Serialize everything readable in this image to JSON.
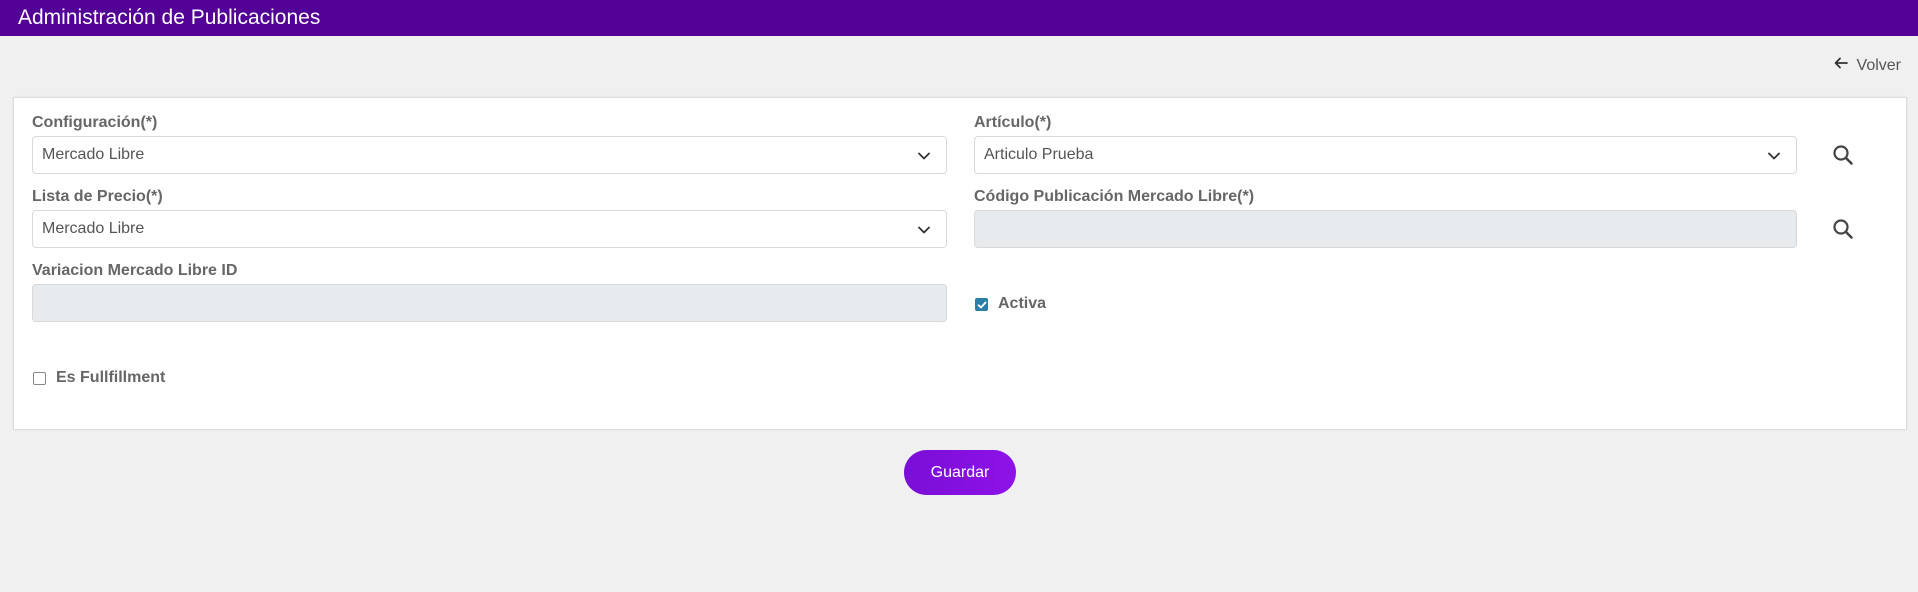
{
  "header": {
    "title": "Administración de Publicaciones"
  },
  "nav": {
    "back_label": "Volver"
  },
  "form": {
    "configuracion": {
      "label": "Configuración(*)",
      "value": "Mercado Libre"
    },
    "articulo": {
      "label": "Artículo(*)",
      "value": "Articulo Prueba"
    },
    "lista_precio": {
      "label": "Lista de Precio(*)",
      "value": "Mercado Libre"
    },
    "codigo_publicacion": {
      "label": "Código Publicación Mercado Libre(*)",
      "value": ""
    },
    "variacion_id": {
      "label": "Variacion Mercado Libre ID",
      "value": ""
    },
    "activa": {
      "label": "Activa",
      "checked": true
    },
    "fullfillment": {
      "label": "Es Fullfillment",
      "checked": false
    }
  },
  "actions": {
    "save_label": "Guardar"
  },
  "colors": {
    "header_bg": "#520096",
    "primary_button": "#8510e0",
    "checkbox_checked": "#2a7fa8"
  },
  "icons": [
    "arrow-left-icon",
    "chevron-down-icon",
    "search-icon",
    "check-icon"
  ]
}
